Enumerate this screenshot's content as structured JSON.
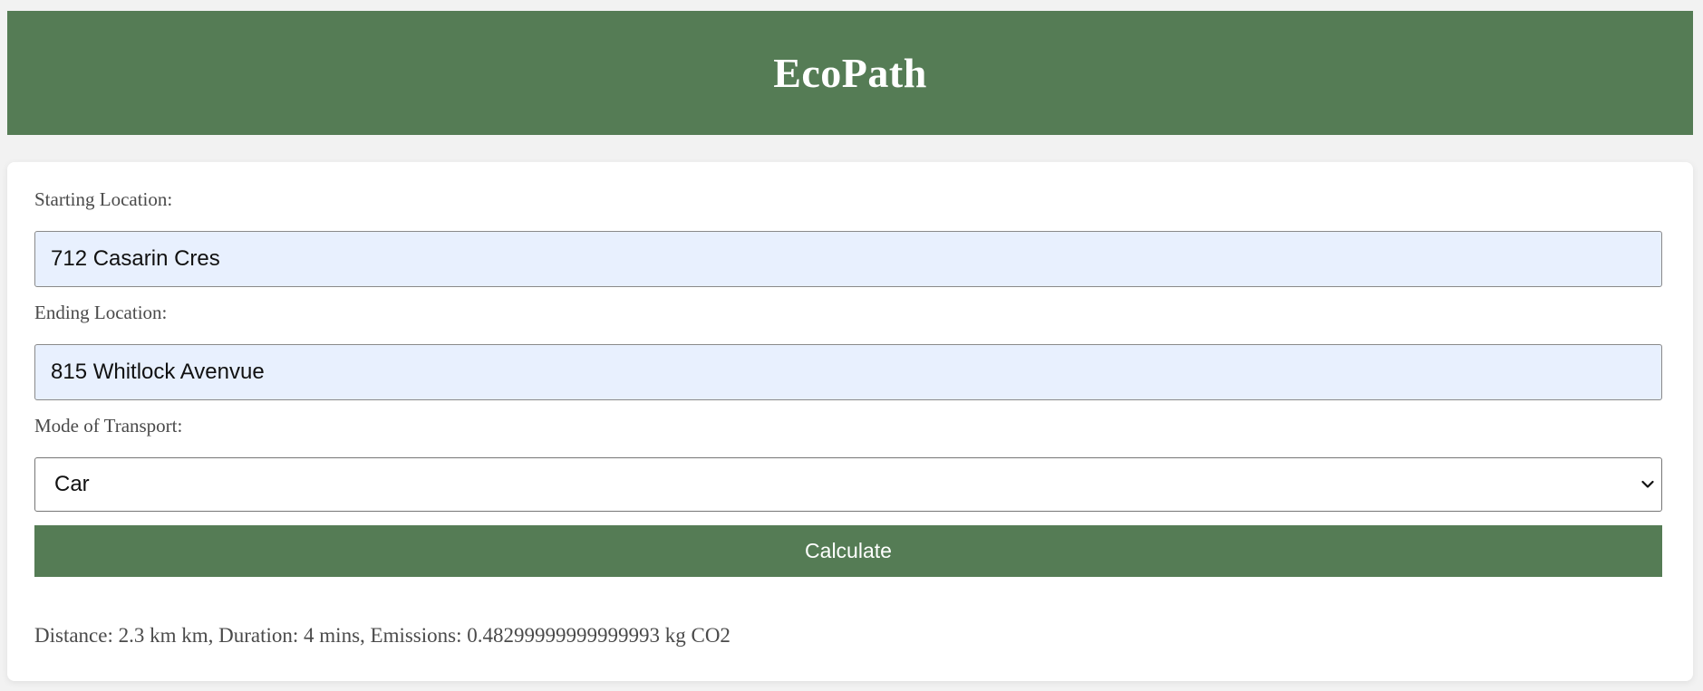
{
  "header": {
    "title": "EcoPath"
  },
  "form": {
    "start_label": "Starting Location:",
    "start_value": "712 Casarin Cres",
    "end_label": "Ending Location:",
    "end_value": "815 Whitlock Avenvue",
    "mode_label": "Mode of Transport:",
    "mode_value": "Car",
    "calculate_label": "Calculate"
  },
  "result": {
    "text": "Distance: 2.3 km km, Duration: 4 mins, Emissions: 0.48299999999999993 kg CO2"
  },
  "colors": {
    "brand_green": "#557c55",
    "input_fill": "#e8f0fe",
    "page_background": "#f2f2f2"
  },
  "icons": {
    "select_arrow": "chevron-down-icon"
  }
}
